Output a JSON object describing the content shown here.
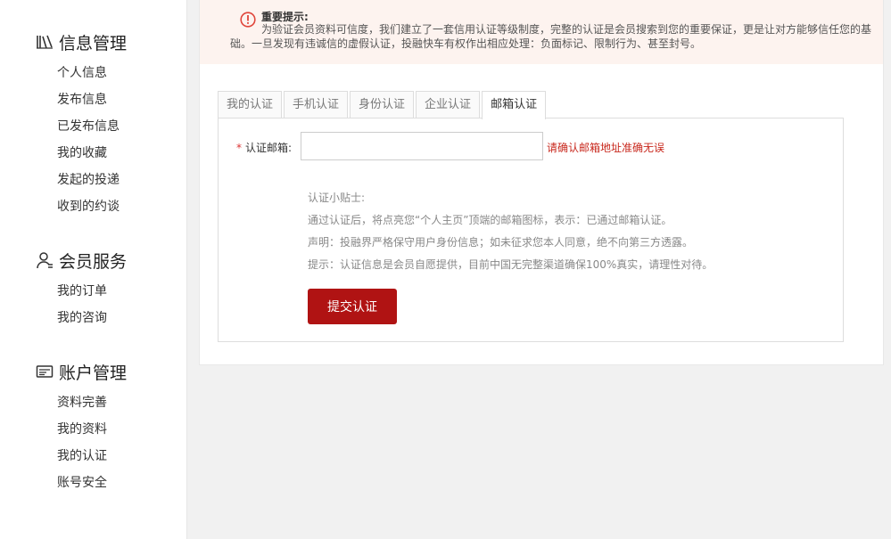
{
  "sidebar": {
    "sections": [
      {
        "title": "信息管理",
        "icon": "books-icon",
        "items": [
          "个人信息",
          "发布信息",
          "已发布信息",
          "我的收藏",
          "发起的投递",
          "收到的约谈"
        ]
      },
      {
        "title": "会员服务",
        "icon": "user-icon",
        "items": [
          "我的订单",
          "我的咨询"
        ]
      },
      {
        "title": "账户管理",
        "icon": "card-icon",
        "items": [
          "资料完善",
          "我的资料",
          "我的认证",
          "账号安全"
        ]
      }
    ]
  },
  "notice": {
    "title": "重要提示:",
    "body": "为验证会员资料可信度，我们建立了一套信用认证等级制度，完整的认证是会员搜索到您的重要保证，更是让对方能够信任您的基础。一旦发现有违诚信的虚假认证，投融快车有权作出相应处理：负面标记、限制行为、甚至封号。",
    "icon": "warning-circle-icon",
    "icon_color": "#e0453a"
  },
  "tabs": [
    "我的认证",
    "手机认证",
    "身份认证",
    "企业认证",
    "邮箱认证"
  ],
  "active_tab": "邮箱认证",
  "form": {
    "required_mark": "*",
    "email_label": "认证邮箱:",
    "email_value": "",
    "email_hint": "请确认邮箱地址准确无误"
  },
  "tips": {
    "heading": "认证小贴士:",
    "lines": [
      "通过认证后，将点亮您“个人主页”顶端的邮箱图标，表示：已通过邮箱认证。",
      "声明：投融界严格保守用户身份信息；如未征求您本人同意，绝不向第三方透露。",
      "提示：认证信息是会员自愿提供，目前中国无完整渠道确保100%真实，请理性对待。"
    ]
  },
  "submit_label": "提交认证",
  "colors": {
    "accent": "#b01313",
    "hint": "#c8281d",
    "notice_bg": "#fdf3ef"
  }
}
